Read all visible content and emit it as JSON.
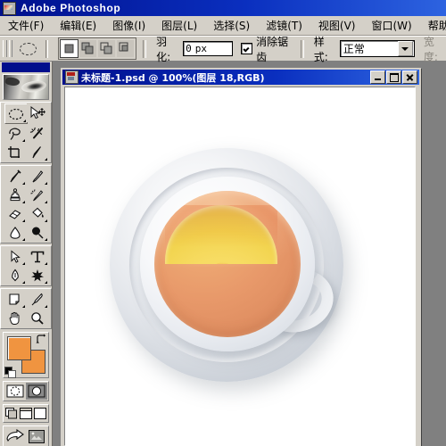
{
  "app": {
    "title": "Adobe Photoshop",
    "icon": "photoshop-icon"
  },
  "menubar": {
    "items": [
      {
        "label": "文件(F)",
        "name": "menu-file"
      },
      {
        "label": "编辑(E)",
        "name": "menu-edit"
      },
      {
        "label": "图像(I)",
        "name": "menu-image"
      },
      {
        "label": "图层(L)",
        "name": "menu-layer"
      },
      {
        "label": "选择(S)",
        "name": "menu-select"
      },
      {
        "label": "滤镜(T)",
        "name": "menu-filter"
      },
      {
        "label": "视图(V)",
        "name": "menu-view"
      },
      {
        "label": "窗口(W)",
        "name": "menu-window"
      },
      {
        "label": "帮助(H)",
        "name": "menu-help"
      }
    ]
  },
  "options_bar": {
    "current_tool": "elliptical-marquee",
    "selection_modes": [
      {
        "name": "new-selection",
        "selected": true
      },
      {
        "name": "add-to-selection",
        "selected": false
      },
      {
        "name": "subtract-from-selection",
        "selected": false
      },
      {
        "name": "intersect-selection",
        "selected": false
      }
    ],
    "feather_label": "羽化:",
    "feather_value": "0",
    "feather_unit": "px",
    "antialias_label": "消除锯齿",
    "antialias_checked": true,
    "style_label": "样式:",
    "style_value": "正常",
    "width_label": "宽度:"
  },
  "toolbox": {
    "tools": [
      {
        "row": 1,
        "left": {
          "name": "elliptical-marquee-tool",
          "active": true
        },
        "right": {
          "name": "move-tool",
          "active": false
        }
      },
      {
        "row": 2,
        "left": {
          "name": "lasso-tool",
          "active": false
        },
        "right": {
          "name": "magic-wand-tool",
          "active": false
        }
      },
      {
        "row": 3,
        "left": {
          "name": "crop-tool",
          "active": false
        },
        "right": {
          "name": "slice-tool",
          "active": false
        }
      },
      {
        "row": 4,
        "left": {
          "name": "healing-brush-tool",
          "active": false
        },
        "right": {
          "name": "brush-tool",
          "active": false
        }
      },
      {
        "row": 5,
        "left": {
          "name": "clone-stamp-tool",
          "active": false
        },
        "right": {
          "name": "history-brush-tool",
          "active": false
        }
      },
      {
        "row": 6,
        "left": {
          "name": "eraser-tool",
          "active": false
        },
        "right": {
          "name": "paint-bucket-tool",
          "active": false
        }
      },
      {
        "row": 7,
        "left": {
          "name": "blur-tool",
          "active": false
        },
        "right": {
          "name": "dodge-tool",
          "active": false
        }
      },
      {
        "row": 8,
        "left": {
          "name": "path-selection-tool",
          "active": false
        },
        "right": {
          "name": "type-tool",
          "active": false
        }
      },
      {
        "row": 9,
        "left": {
          "name": "pen-tool",
          "active": false
        },
        "right": {
          "name": "custom-shape-tool",
          "active": false
        }
      },
      {
        "row": 10,
        "left": {
          "name": "notes-tool",
          "active": false
        },
        "right": {
          "name": "eyedropper-tool",
          "active": false
        }
      },
      {
        "row": 11,
        "left": {
          "name": "hand-tool",
          "active": false
        },
        "right": {
          "name": "zoom-tool",
          "active": false
        }
      }
    ],
    "foreground_color": "#F09440",
    "background_color": "#F09440",
    "mask_modes": [
      {
        "name": "standard-mask-mode",
        "selected": true
      },
      {
        "name": "quick-mask-mode",
        "selected": false
      }
    ],
    "screen_modes": [
      {
        "name": "standard-screen-mode",
        "selected": true
      },
      {
        "name": "full-screen-with-menubar-mode",
        "selected": false
      },
      {
        "name": "full-screen-mode",
        "selected": false
      }
    ],
    "jump_to": [
      {
        "name": "jump-to-imageready-button"
      },
      {
        "name": "imageready-preview-button"
      }
    ]
  },
  "document": {
    "title": "未标题-1.psd @ 100%(图层  18,RGB)",
    "filename": "未标题-1.psd",
    "zoom": "100%",
    "layer": "图层  18",
    "color_mode": "RGB",
    "window_buttons": [
      {
        "name": "minimize-button",
        "label": "_"
      },
      {
        "name": "maximize-button",
        "label": "□"
      },
      {
        "name": "close-button",
        "label": "×"
      }
    ],
    "canvas": {
      "background": "#FFFFFF",
      "artwork": "teacup-with-lemon-slice-top-view",
      "saucer_color": "#E2E5EA",
      "cup_color": "#F0F2F5",
      "tea_color": "#E8996A",
      "lemon_color": "#F7DC63",
      "lemon_segment_color": "#F4863F"
    }
  }
}
